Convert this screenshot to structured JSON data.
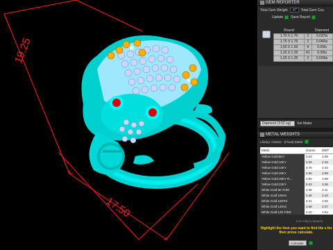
{
  "gem_reporter": {
    "title": "GEM REPORTER",
    "total_gem_weight_label": "Total Gem Weight",
    "total_gem_weight_value": ".47",
    "total_gem_count_label": "Total Gem Cou",
    "update_label": "Update",
    "save_report_label": "Save Report",
    "table_headers": [
      "Round",
      "Diamond"
    ],
    "rows": [
      {
        "size": "1.70 X 1.70",
        "count": "2",
        "weight": "0.037ts"
      },
      {
        "size": "1.75 X 1.75",
        "count": "2",
        "weight": "0.040ts"
      },
      {
        "size": "1.50 X 1.50",
        "count": "4",
        "weight": "0.05ts"
      },
      {
        "size": "1.25 X 1.25",
        "count": "41",
        "weight": "0.30ts"
      },
      {
        "size": "1.25 X 1.25",
        "count": "2",
        "weight": "0.039ts"
      }
    ],
    "diamond_select": "Diamond    (3.52 sg)",
    "set_material_label": "Set Mater"
  },
  "metal_weights": {
    "title": "METAL WEIGHTS",
    "library_label": "Library: Classic - (Fixed) Metal",
    "headers": [
      "Metal",
      "Grams",
      "DWT"
    ],
    "rows": [
      {
        "metal": "Yellow Gold:9KY",
        "grams": "3.23",
        "dwt": "2.08"
      },
      {
        "metal": "Yellow Gold:10KY",
        "grams": "3.34",
        "dwt": "2.15"
      },
      {
        "metal": "Yellow Gold:14KY",
        "grams": "3.76",
        "dwt": "2.42"
      },
      {
        "metal": "Yellow Gold:18KY",
        "grams": "4.50",
        "dwt": "2.89"
      },
      {
        "metal": "Yellow Gold:18KY R...",
        "grams": "4.50",
        "dwt": "2.89"
      },
      {
        "metal": "Yellow Gold:22KY",
        "grams": "5.22",
        "dwt": "3.36"
      },
      {
        "metal": "White Gold:9K PdW",
        "grams": "3.28",
        "dwt": "2.11"
      },
      {
        "metal": "White Gold:10KNi",
        "grams": "3.26",
        "dwt": "2.10"
      },
      {
        "metal": "White Gold:10KPd",
        "grams": "3.21",
        "dwt": "2.06"
      },
      {
        "metal": "White Gold:14KNi",
        "grams": "3.68",
        "dwt": "2.37"
      },
      {
        "metal": "White Gold:14K PdW",
        "grams": "4.10",
        "dwt": "2.64"
      }
    ],
    "use_object_label": "Use Object Materia",
    "hint": "Highlight the item you want to find the s for then press calculate.",
    "calculate_label": "Calculate"
  },
  "viewport": {
    "dimension_1": "19.25",
    "dimension_2": "17.50",
    "label_color": "#ff2020",
    "model_color": "#00e5e5"
  },
  "colors": {
    "accent_green": "#16a62a",
    "hint_yellow": "#ffd400"
  }
}
